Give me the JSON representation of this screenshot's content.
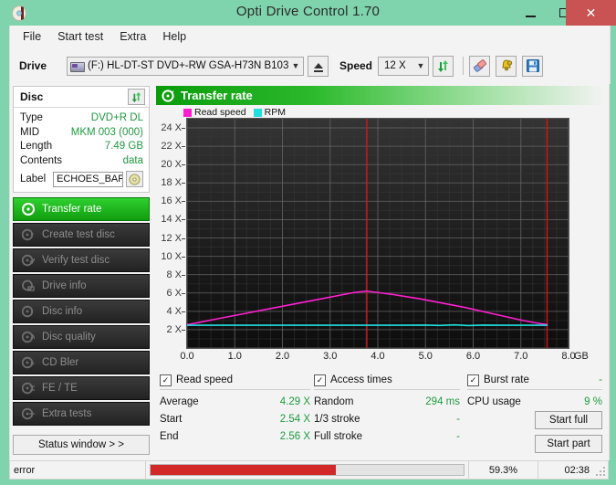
{
  "window": {
    "title": "Opti Drive Control 1.70",
    "icon": "disc-icon",
    "minimize": "minimize-icon",
    "maximize": "maximize-icon",
    "close": "close-icon"
  },
  "menu": {
    "items": [
      "File",
      "Start test",
      "Extra",
      "Help"
    ]
  },
  "toolbar": {
    "drive_label": "Drive",
    "drive_value": "(F:)  HL-DT-ST DVD+-RW GSA-H73N B103",
    "eject_title": "eject-icon",
    "speed_label": "Speed",
    "speed_value": "12 X",
    "refresh_icon": "refresh-icon",
    "erase_icon": "eraser-icon",
    "settings_icon": "bell-icon",
    "save_icon": "save-icon"
  },
  "disc": {
    "panel_title": "Disc",
    "refresh_icon": "refresh-icon",
    "rows": [
      {
        "key": "Type",
        "value": "DVD+R DL"
      },
      {
        "key": "MID",
        "value": "MKM 003 (000)"
      },
      {
        "key": "Length",
        "value": "7.49 GB"
      },
      {
        "key": "Contents",
        "value": "data"
      }
    ],
    "label_key": "Label",
    "label_value": "ECHOES_BARE",
    "label_button_icon": "cd-icon"
  },
  "sidebar": {
    "items": [
      {
        "label": "Transfer rate",
        "icon": "disc-test-icon",
        "active": true
      },
      {
        "label": "Create test disc",
        "icon": "disc-create-icon",
        "active": false
      },
      {
        "label": "Verify test disc",
        "icon": "disc-verify-icon",
        "active": false
      },
      {
        "label": "Drive info",
        "icon": "drive-info-icon",
        "active": false
      },
      {
        "label": "Disc info",
        "icon": "disc-info-icon",
        "active": false
      },
      {
        "label": "Disc quality",
        "icon": "disc-quality-icon",
        "active": false
      },
      {
        "label": "CD Bler",
        "icon": "cd-bler-icon",
        "active": false
      },
      {
        "label": "FE / TE",
        "icon": "fe-te-icon",
        "active": false
      },
      {
        "label": "Extra tests",
        "icon": "extra-tests-icon",
        "active": false
      }
    ],
    "status_button": "Status window > >"
  },
  "chart_panel": {
    "header": "Transfer rate",
    "header_icon": "transfer-rate-icon"
  },
  "chart_data": {
    "type": "line",
    "title": "Transfer rate",
    "xlabel": "GB",
    "ylabel": "X",
    "xlim": [
      0.0,
      8.0
    ],
    "ylim": [
      0,
      25
    ],
    "xticks": [
      0.0,
      1.0,
      2.0,
      3.0,
      4.0,
      5.0,
      6.0,
      7.0,
      8.0
    ],
    "xtick_labels": [
      "0.0",
      "1.0",
      "2.0",
      "3.0",
      "4.0",
      "5.0",
      "6.0",
      "7.0",
      "8.0"
    ],
    "x_unit": "GB",
    "yticks": [
      2,
      4,
      6,
      8,
      10,
      12,
      14,
      16,
      18,
      20,
      22,
      24
    ],
    "ytick_labels": [
      "2 X",
      "4 X",
      "6 X",
      "8 X",
      "10 X",
      "12 X",
      "14 X",
      "16 X",
      "18 X",
      "20 X",
      "22 X",
      "24 X"
    ],
    "grid": true,
    "background": "#141414",
    "legend_position": "top-left",
    "legend": [
      {
        "name": "Read speed",
        "color": "#ff1fd1"
      },
      {
        "name": "RPM",
        "color": "#22e0e0"
      }
    ],
    "markers": [
      {
        "name": "layer-break",
        "x": 3.77,
        "color": "#e01010"
      },
      {
        "name": "disc-end",
        "x": 7.55,
        "color": "#e01010"
      }
    ],
    "series": [
      {
        "name": "Read speed",
        "color": "#ff1fd1",
        "points": [
          [
            0.0,
            2.54
          ],
          [
            0.25,
            2.78
          ],
          [
            0.5,
            3.05
          ],
          [
            0.75,
            3.3
          ],
          [
            1.0,
            3.55
          ],
          [
            1.25,
            3.8
          ],
          [
            1.5,
            4.05
          ],
          [
            1.75,
            4.3
          ],
          [
            2.0,
            4.55
          ],
          [
            2.25,
            4.8
          ],
          [
            2.5,
            5.05
          ],
          [
            2.75,
            5.3
          ],
          [
            3.0,
            5.55
          ],
          [
            3.25,
            5.8
          ],
          [
            3.5,
            6.05
          ],
          [
            3.77,
            6.2
          ],
          [
            4.0,
            6.05
          ],
          [
            4.3,
            5.85
          ],
          [
            4.6,
            5.6
          ],
          [
            4.9,
            5.35
          ],
          [
            5.2,
            5.05
          ],
          [
            5.5,
            4.75
          ],
          [
            5.8,
            4.45
          ],
          [
            6.1,
            4.1
          ],
          [
            6.4,
            3.75
          ],
          [
            6.7,
            3.4
          ],
          [
            7.0,
            3.05
          ],
          [
            7.3,
            2.75
          ],
          [
            7.55,
            2.56
          ]
        ]
      },
      {
        "name": "RPM",
        "color": "#22e0e0",
        "points": [
          [
            0.0,
            2.48
          ],
          [
            1.0,
            2.48
          ],
          [
            2.0,
            2.48
          ],
          [
            3.0,
            2.48
          ],
          [
            3.77,
            2.48
          ],
          [
            4.4,
            2.48
          ],
          [
            5.0,
            2.5
          ],
          [
            5.3,
            2.46
          ],
          [
            5.6,
            2.52
          ],
          [
            5.9,
            2.45
          ],
          [
            6.2,
            2.5
          ],
          [
            6.6,
            2.48
          ],
          [
            7.0,
            2.48
          ],
          [
            7.55,
            2.48
          ]
        ]
      }
    ]
  },
  "stats": {
    "read_speed": {
      "title": "Read speed",
      "checked": true,
      "rows": [
        {
          "key": "Average",
          "value": "4.29 X"
        },
        {
          "key": "Start",
          "value": "2.54 X"
        },
        {
          "key": "End",
          "value": "2.56 X"
        }
      ]
    },
    "access_times": {
      "title": "Access times",
      "checked": true,
      "rows": [
        {
          "key": "Random",
          "value": "294 ms"
        },
        {
          "key": "1/3 stroke",
          "value": "-"
        },
        {
          "key": "Full stroke",
          "value": "-"
        }
      ]
    },
    "burst_rate": {
      "title": "Burst rate",
      "checked": true,
      "value": "-",
      "rows": [
        {
          "key": "CPU usage",
          "value": "9 %"
        }
      ],
      "buttons": {
        "start_full": "Start full",
        "start_part": "Start part"
      }
    }
  },
  "statusbar": {
    "message": "error",
    "progress_percent": 59.3,
    "progress_text": "59.3%",
    "time": "02:38",
    "progress_color": "#d22828"
  }
}
